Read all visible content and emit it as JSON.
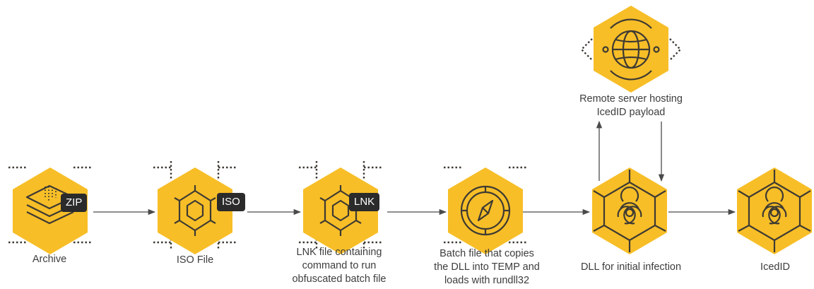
{
  "colors": {
    "hexagon": "#F7BE27",
    "icon_stroke": "#3E3A33",
    "arrow": "#4a4a4a",
    "badge_bg": "#2b2b2b",
    "badge_text": "#ffffff",
    "text": "#3d3d3d"
  },
  "nodes": {
    "archive": {
      "label": "Archive",
      "badge": "ZIP",
      "icon": "layers-icon"
    },
    "iso": {
      "label": "ISO File",
      "badge": "ISO",
      "icon": "hexagon-gear-icon"
    },
    "lnk": {
      "label": "LNK file containing\ncommand to run\nobfuscated batch file",
      "badge": "LNK",
      "icon": "hexagon-gear-icon"
    },
    "batch": {
      "label": "Batch file that copies\nthe DLL into TEMP and\nloads with rundll32",
      "icon": "compass-icon"
    },
    "dll": {
      "label": "DLL for initial infection",
      "icon": "biohazard-icon"
    },
    "icedid": {
      "label": "IcedID",
      "icon": "biohazard-icon"
    },
    "server": {
      "label": "Remote server hosting\nIcedID payload",
      "icon": "globe-icon"
    }
  }
}
